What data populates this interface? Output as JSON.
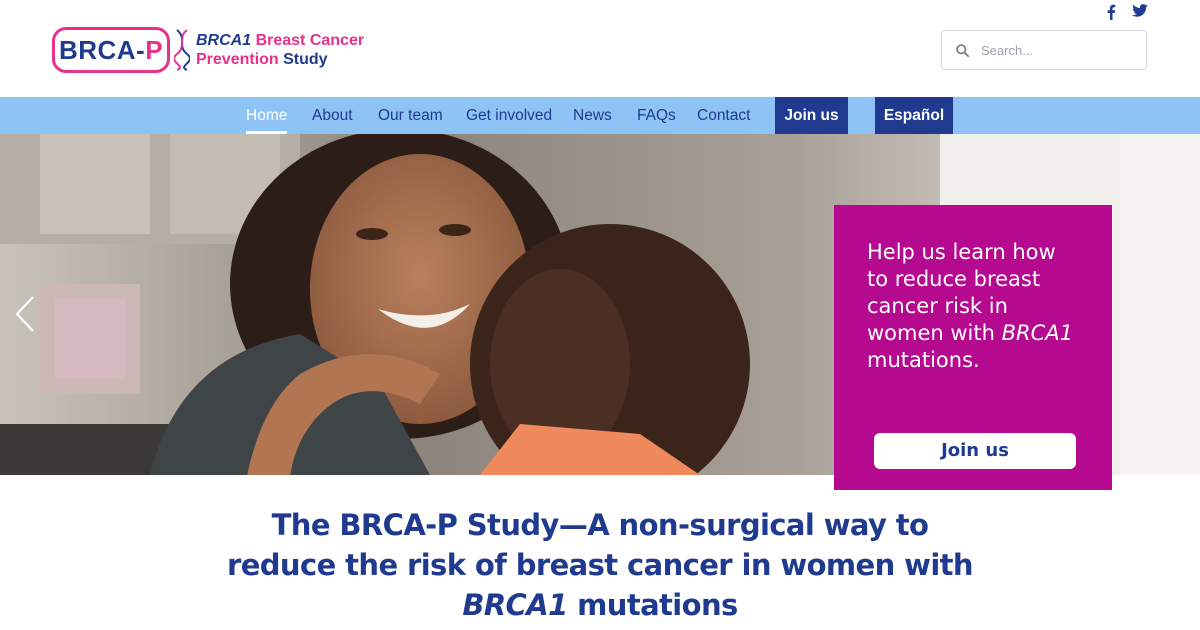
{
  "header": {
    "logo": {
      "badge_main": "BRCA-",
      "badge_accent": "P",
      "line1_gene": "BRCA1",
      "line1_rest": " Breast Cancer",
      "line2_accent": "Prevention",
      "line2_rest": " Study"
    },
    "social": [
      "facebook-icon",
      "twitter-icon"
    ],
    "search": {
      "placeholder": "Search..."
    }
  },
  "nav": {
    "items": [
      {
        "label": "Home",
        "active": true
      },
      {
        "label": "About"
      },
      {
        "label": "Our team"
      },
      {
        "label": "Get involved"
      },
      {
        "label": "News"
      },
      {
        "label": "FAQs"
      },
      {
        "label": "Contact"
      }
    ],
    "join_label": "Join us",
    "spanish_label": "Español"
  },
  "hero": {
    "promo": {
      "text_before": "Help us learn how to reduce breast cancer risk in women with ",
      "text_gene": "BRCA1",
      "text_after": " mutations.",
      "button_label": "Join us"
    }
  },
  "headline": {
    "before": "The BRCA-P Study—A non-surgical way to reduce the risk of breast cancer in women with ",
    "gene": "BRCA1",
    "after": " mutations"
  },
  "colors": {
    "navy": "#1f3a8f",
    "pink": "#e7318c",
    "magenta_panel": "#b5098f",
    "nav_bg": "#8ec3f6"
  }
}
